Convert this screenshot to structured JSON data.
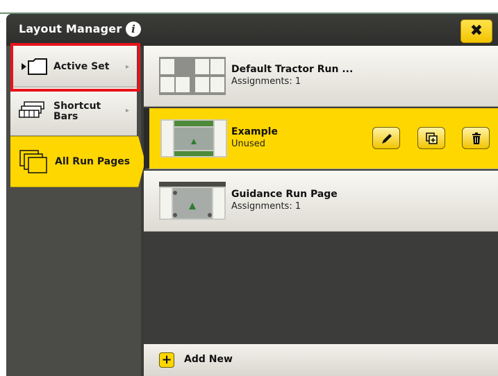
{
  "header": {
    "title": "Layout Manager",
    "info_icon": "info-icon",
    "close_symbol": "✖"
  },
  "nav": {
    "items": [
      {
        "label": "Active Set",
        "icon": "folder-icon",
        "arrow": "▸",
        "highlighted": true
      },
      {
        "label": "Shortcut Bars",
        "label_line1": "Shortcut",
        "label_line2": "Bars",
        "icon": "shortcut-bars-icon",
        "arrow": "▸"
      },
      {
        "label": "All Run Pages",
        "icon": "stacked-pages-icon",
        "selected": true
      }
    ]
  },
  "run_pages": [
    {
      "name": "Default Tractor Run ...",
      "status": "Assignments: 1"
    },
    {
      "name": "Example",
      "status": "Unused",
      "selected": true
    },
    {
      "name": "Guidance Run Page",
      "status": "Assignments: 1"
    }
  ],
  "row_actions": [
    "edit-pencil-icon",
    "duplicate-icon",
    "delete-trash-icon"
  ],
  "footer": {
    "add_label": "Add New",
    "add_symbol": "+"
  },
  "colors": {
    "accent_yellow": "#ffd700",
    "highlight_red": "#e8131b",
    "dark_frame": "#3a3a38"
  }
}
